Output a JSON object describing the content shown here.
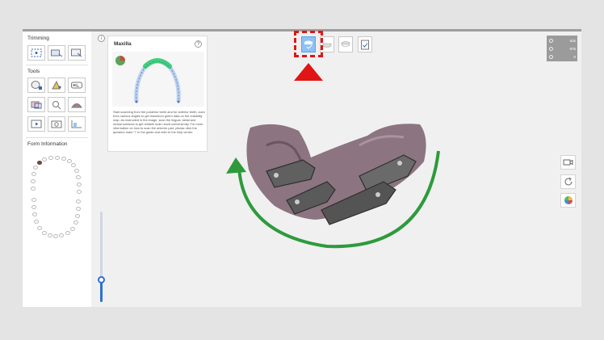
{
  "left_panel": {
    "trimming_title": "Trimming",
    "tools_title": "Tools",
    "form_info_title": "Form Information"
  },
  "guide": {
    "title": "Maxilla",
    "help_glyph": "?",
    "text": "Start scanning from the posterior teeth and for anterior teeth, scan from various angles to get maximum green data on the reliability map. As instructed in the image, scan the lingual, labial and incisal surfaces to get reliable scan result conveniently. For more information on how to scan the anterior part, please click the question mark '?' in the guide and refer to the help center."
  },
  "info_glyph": "i",
  "stats": [
    {
      "icon": "timer-icon",
      "value": "53s"
    },
    {
      "icon": "shot-count-icon",
      "value": "975"
    },
    {
      "icon": "data-icon",
      "value": "0"
    }
  ],
  "step_icons": [
    "maxilla-scan-icon",
    "mandible-scan-icon",
    "occlusion-scan-icon",
    "review-check-icon"
  ],
  "colors": {
    "highlight": "#e01515",
    "arrow": "#2e9a3c",
    "slider": "#2e6fd8",
    "active_step": "#8fc1f5",
    "stats_bg": "#9b9b9b"
  },
  "slider_value": 0.25
}
